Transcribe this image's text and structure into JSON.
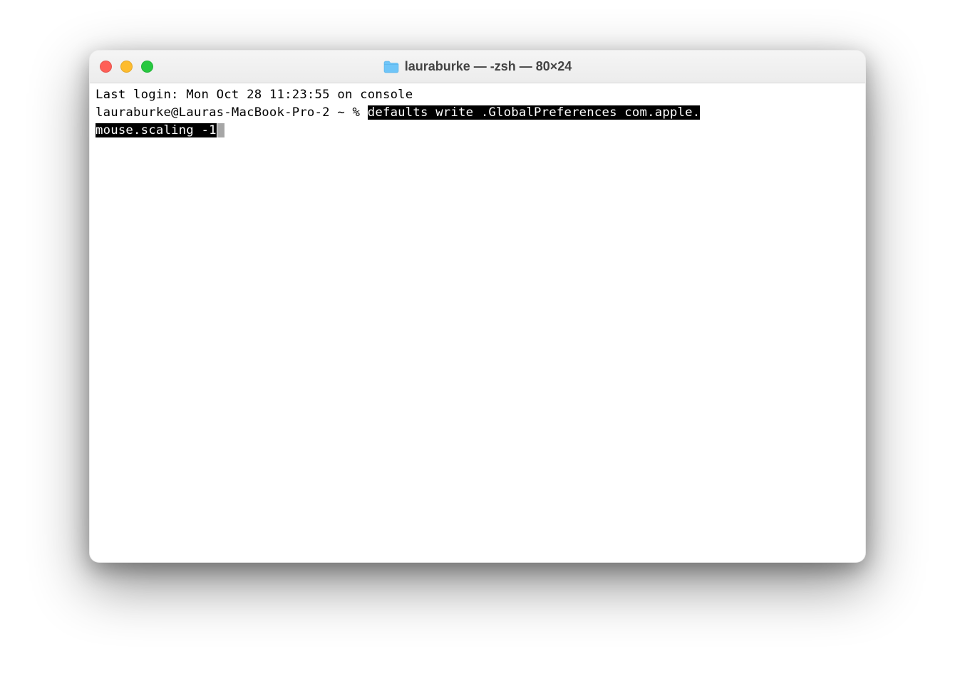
{
  "window": {
    "title": "lauraburke — -zsh — 80×24"
  },
  "terminal": {
    "last_login": "Last login: Mon Oct 28 11:23:55 on console",
    "prompt": "lauraburke@Lauras-MacBook-Pro-2 ~ % ",
    "command_selected_part1": "defaults write .GlobalPreferences com.apple.",
    "command_selected_part2": "mouse.scaling -1"
  },
  "colors": {
    "close": "#ff5f57",
    "minimize": "#febc2e",
    "maximize": "#28c840",
    "folder": "#6fc5f8"
  }
}
